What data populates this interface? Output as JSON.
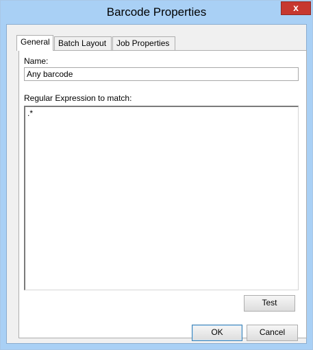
{
  "window": {
    "title": "Barcode Properties",
    "close_glyph": "x",
    "title_bar_color": "#a9d0f5"
  },
  "tabs": [
    {
      "label": "General",
      "active": true
    },
    {
      "label": "Batch Layout",
      "active": false
    },
    {
      "label": "Job Properties",
      "active": false
    }
  ],
  "general": {
    "name_label": "Name:",
    "name_value": "Any barcode",
    "regex_label": "Regular Expression to match:",
    "regex_value": ".*",
    "test_label": "Test"
  },
  "footer": {
    "ok_label": "OK",
    "cancel_label": "Cancel"
  }
}
